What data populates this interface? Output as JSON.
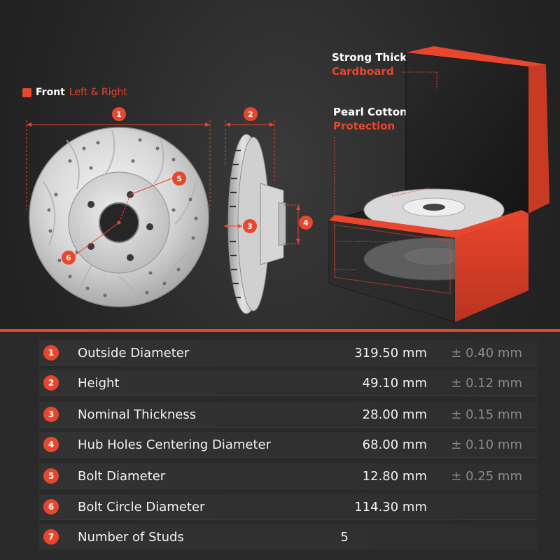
{
  "legend": {
    "primary": "Front",
    "secondary": "Left & Right"
  },
  "callouts": {
    "cardboard": {
      "line1": "Strong Thick",
      "line2": "Cardboard"
    },
    "cotton": {
      "line1": "Pearl Cotton",
      "line2": "Protection"
    }
  },
  "badges": [
    "1",
    "2",
    "3",
    "4",
    "5",
    "6"
  ],
  "specs": [
    {
      "num": "1",
      "label": "Outside Diameter",
      "value": "319.50 mm",
      "tolerance": "± 0.40 mm"
    },
    {
      "num": "2",
      "label": "Height",
      "value": "49.10 mm",
      "tolerance": "± 0.12 mm"
    },
    {
      "num": "3",
      "label": "Nominal Thickness",
      "value": "28.00 mm",
      "tolerance": "± 0.15 mm"
    },
    {
      "num": "4",
      "label": "Hub Holes Centering Diameter",
      "value": "68.00 mm",
      "tolerance": "± 0.10 mm"
    },
    {
      "num": "5",
      "label": "Bolt Diameter",
      "value": "12.80 mm",
      "tolerance": "± 0.25 mm"
    },
    {
      "num": "6",
      "label": "Bolt Circle Diameter",
      "value": "114.30 mm",
      "tolerance": ""
    },
    {
      "num": "7",
      "label": "Number of Studs",
      "value": "5",
      "tolerance": ""
    }
  ],
  "colors": {
    "accent": "#e8462d",
    "background": "#262626",
    "tolerance_text": "#8a8a8a"
  }
}
